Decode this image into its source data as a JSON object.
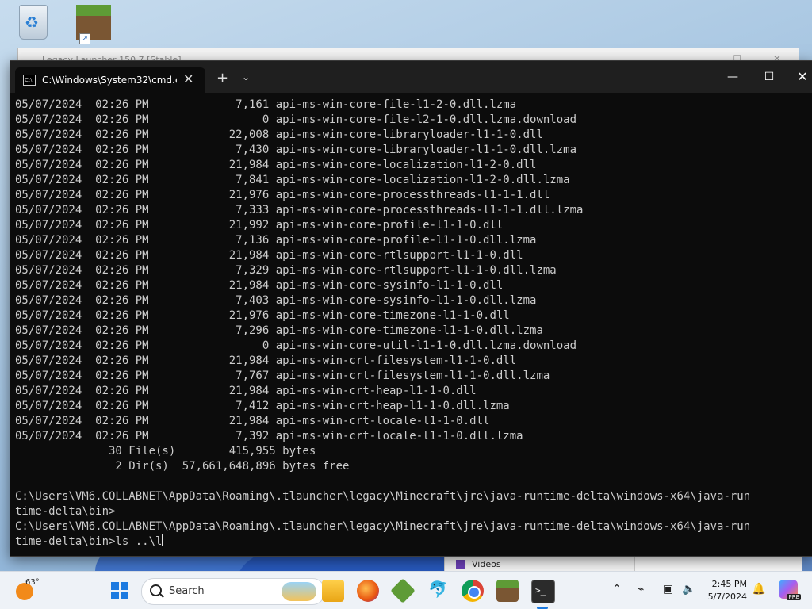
{
  "desktop": {
    "recycle_bin_label": "Re",
    "launcher_title": "Legacy Launcher 150.7 [Stable]",
    "explorer_label": "Videos"
  },
  "terminal": {
    "tab_title": "C:\\Windows\\System32\\cmd.e",
    "new_tab": "+",
    "dropdown": "⌄",
    "close_tab": "✕",
    "controls": {
      "minimize": "—",
      "maximize": "☐",
      "close": "✕"
    },
    "lines": [
      "05/07/2024  02:26 PM             7,161 api-ms-win-core-file-l1-2-0.dll.lzma",
      "05/07/2024  02:26 PM                 0 api-ms-win-core-file-l2-1-0.dll.lzma.download",
      "05/07/2024  02:26 PM            22,008 api-ms-win-core-libraryloader-l1-1-0.dll",
      "05/07/2024  02:26 PM             7,430 api-ms-win-core-libraryloader-l1-1-0.dll.lzma",
      "05/07/2024  02:26 PM            21,984 api-ms-win-core-localization-l1-2-0.dll",
      "05/07/2024  02:26 PM             7,841 api-ms-win-core-localization-l1-2-0.dll.lzma",
      "05/07/2024  02:26 PM            21,976 api-ms-win-core-processthreads-l1-1-1.dll",
      "05/07/2024  02:26 PM             7,333 api-ms-win-core-processthreads-l1-1-1.dll.lzma",
      "05/07/2024  02:26 PM            21,992 api-ms-win-core-profile-l1-1-0.dll",
      "05/07/2024  02:26 PM             7,136 api-ms-win-core-profile-l1-1-0.dll.lzma",
      "05/07/2024  02:26 PM            21,984 api-ms-win-core-rtlsupport-l1-1-0.dll",
      "05/07/2024  02:26 PM             7,329 api-ms-win-core-rtlsupport-l1-1-0.dll.lzma",
      "05/07/2024  02:26 PM            21,984 api-ms-win-core-sysinfo-l1-1-0.dll",
      "05/07/2024  02:26 PM             7,403 api-ms-win-core-sysinfo-l1-1-0.dll.lzma",
      "05/07/2024  02:26 PM            21,976 api-ms-win-core-timezone-l1-1-0.dll",
      "05/07/2024  02:26 PM             7,296 api-ms-win-core-timezone-l1-1-0.dll.lzma",
      "05/07/2024  02:26 PM                 0 api-ms-win-core-util-l1-1-0.dll.lzma.download",
      "05/07/2024  02:26 PM            21,984 api-ms-win-crt-filesystem-l1-1-0.dll",
      "05/07/2024  02:26 PM             7,767 api-ms-win-crt-filesystem-l1-1-0.dll.lzma",
      "05/07/2024  02:26 PM            21,984 api-ms-win-crt-heap-l1-1-0.dll",
      "05/07/2024  02:26 PM             7,412 api-ms-win-crt-heap-l1-1-0.dll.lzma",
      "05/07/2024  02:26 PM            21,984 api-ms-win-crt-locale-l1-1-0.dll",
      "05/07/2024  02:26 PM             7,392 api-ms-win-crt-locale-l1-1-0.dll.lzma",
      "              30 File(s)        415,955 bytes",
      "               2 Dir(s)  57,661,648,896 bytes free",
      "",
      "C:\\Users\\VM6.COLLABNET\\AppData\\Roaming\\.tlauncher\\legacy\\Minecraft\\jre\\java-runtime-delta\\windows-x64\\java-run",
      "time-delta\\bin>",
      "C:\\Users\\VM6.COLLABNET\\AppData\\Roaming\\.tlauncher\\legacy\\Minecraft\\jre\\java-runtime-delta\\windows-x64\\java-run"
    ],
    "prompt_line": "time-delta\\bin>ls ..\\l"
  },
  "taskbar": {
    "weather_temp": "63°",
    "search_placeholder": "Search",
    "terminal_glyph": ">_",
    "clock_time": "2:45 PM",
    "clock_date": "5/7/2024",
    "copilot_badge": "PRE",
    "icons": [
      "windows-start-icon",
      "file-explorer-icon",
      "firefox-icon",
      "minecraft-launcher-icon",
      "dolphin-icon",
      "chrome-icon",
      "minecraft-icon",
      "terminal-icon"
    ]
  }
}
